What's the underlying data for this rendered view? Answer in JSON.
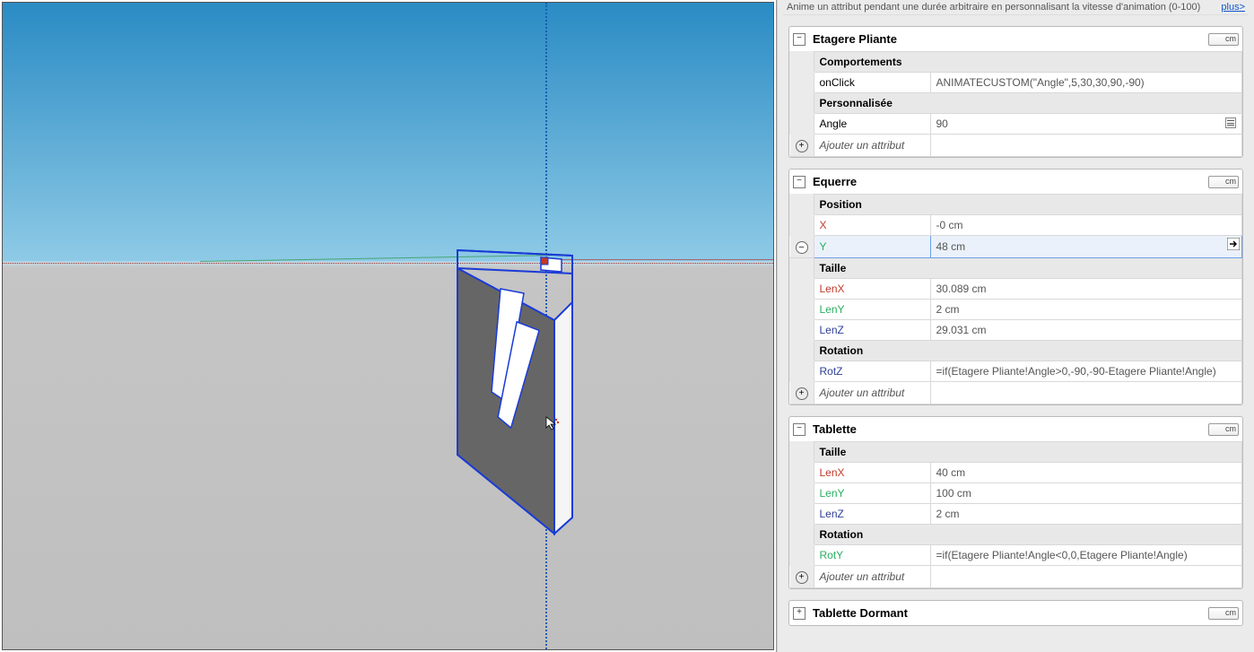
{
  "hint": {
    "text": "Anime un attribut pendant une durée arbitraire en personnalisant la vitesse d'animation (0-100)",
    "link": "plus>"
  },
  "sections": {
    "etagere": {
      "title": "Etagere Pliante",
      "unit": "cm",
      "groups": {
        "comport": {
          "label": "Comportements",
          "rows": {
            "onclick": {
              "key": "onClick",
              "val": "ANIMATECUSTOM(\"Angle\",5,30,30,90,-90)"
            }
          }
        },
        "perso": {
          "label": "Personnalisée",
          "rows": {
            "angle": {
              "key": "Angle",
              "val": "90"
            }
          }
        }
      },
      "add": "Ajouter un attribut"
    },
    "equerre": {
      "title": "Equerre",
      "unit": "cm",
      "groups": {
        "pos": {
          "label": "Position",
          "rows": {
            "x": {
              "key": "X",
              "val": "-0 cm"
            },
            "y": {
              "key": "Y",
              "val": "48 cm"
            }
          }
        },
        "taille": {
          "label": "Taille",
          "rows": {
            "lenx": {
              "key": "LenX",
              "val": "30.089 cm"
            },
            "leny": {
              "key": "LenY",
              "val": "2 cm"
            },
            "lenz": {
              "key": "LenZ",
              "val": "29.031 cm"
            }
          }
        },
        "rot": {
          "label": "Rotation",
          "rows": {
            "rotz": {
              "key": "RotZ",
              "val": "=if(Etagere Pliante!Angle>0,-90,-90-Etagere Pliante!Angle)"
            }
          }
        }
      },
      "add": "Ajouter un attribut"
    },
    "tablette": {
      "title": "Tablette",
      "unit": "cm",
      "groups": {
        "taille": {
          "label": "Taille",
          "rows": {
            "lenx": {
              "key": "LenX",
              "val": "40 cm"
            },
            "leny": {
              "key": "LenY",
              "val": "100 cm"
            },
            "lenz": {
              "key": "LenZ",
              "val": "2 cm"
            }
          }
        },
        "rot": {
          "label": "Rotation",
          "rows": {
            "roty": {
              "key": "RotY",
              "val": "=if(Etagere Pliante!Angle<0,0,Etagere Pliante!Angle)"
            }
          }
        }
      },
      "add": "Ajouter un attribut"
    },
    "dormant": {
      "title": "Tablette Dormant",
      "unit": "cm"
    }
  }
}
